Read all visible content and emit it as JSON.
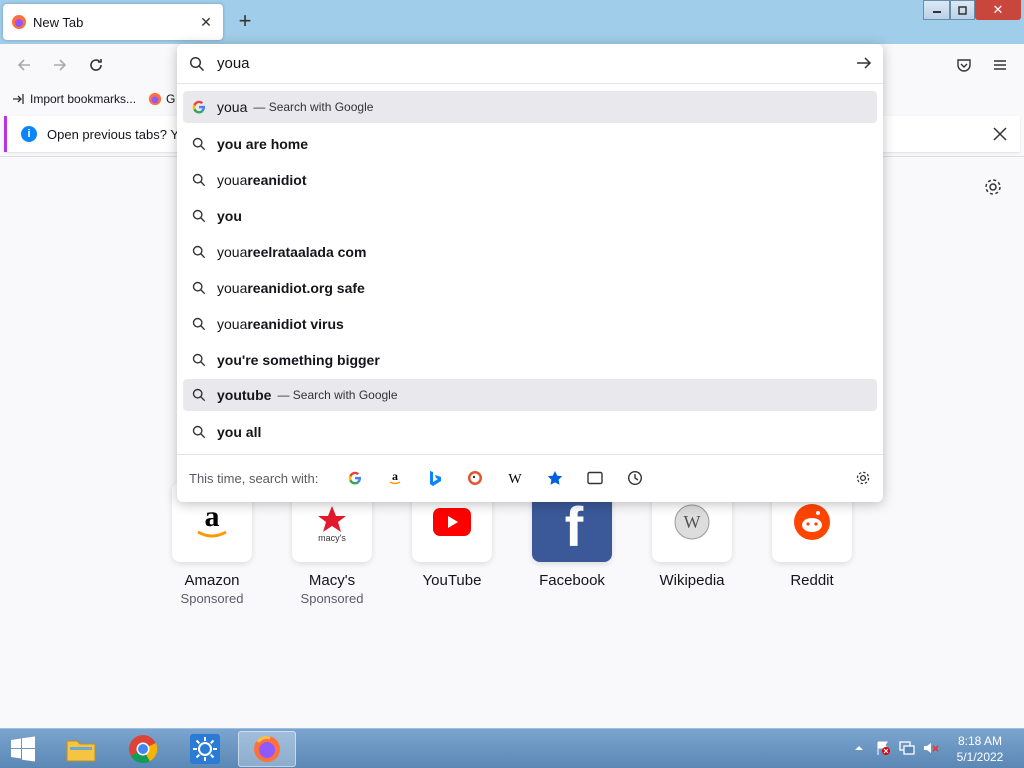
{
  "tab": {
    "title": "New Tab"
  },
  "bookmarks": {
    "items": [
      "Import bookmarks...",
      "G"
    ]
  },
  "notification": {
    "text": "Open previous tabs? You"
  },
  "urlbar": {
    "value": "youa"
  },
  "suggestions": [
    {
      "typed": "youa",
      "bold": "",
      "action": "— Search with Google",
      "icon": "google-icon",
      "highlighted": true
    },
    {
      "typed": "",
      "bold": "you are home",
      "action": "",
      "icon": "search-icon",
      "highlighted": false
    },
    {
      "typed": "youa",
      "bold": "reanidiot",
      "action": "",
      "icon": "search-icon",
      "highlighted": false
    },
    {
      "typed": "",
      "bold": "you",
      "action": "",
      "icon": "search-icon",
      "highlighted": false
    },
    {
      "typed": "youa",
      "bold": "reelrataalada com",
      "action": "",
      "icon": "search-icon",
      "highlighted": false
    },
    {
      "typed": "youa",
      "bold": "reanidiot.org safe",
      "action": "",
      "icon": "search-icon",
      "highlighted": false
    },
    {
      "typed": "youa",
      "bold": "reanidiot virus",
      "action": "",
      "icon": "search-icon",
      "highlighted": false
    },
    {
      "typed": "",
      "bold": "you're something bigger",
      "action": "",
      "icon": "search-icon",
      "highlighted": false
    },
    {
      "typed": "",
      "bold": "youtube",
      "action": "— Search with Google",
      "icon": "search-icon",
      "highlighted": true
    },
    {
      "typed": "",
      "bold": "you all",
      "action": "",
      "icon": "search-icon",
      "highlighted": false
    }
  ],
  "oneoff": {
    "label": "This time, search with:",
    "engines": [
      "google-icon",
      "amazon-icon",
      "bing-icon",
      "duckduckgo-icon",
      "wikipedia-icon",
      "bookmarks-star-icon",
      "tabs-icon",
      "history-icon"
    ]
  },
  "topsites": [
    {
      "name": "Amazon",
      "sponsor": "Sponsored",
      "icon": "amazon-icon"
    },
    {
      "name": "Macy's",
      "sponsor": "Sponsored",
      "icon": "macys-icon"
    },
    {
      "name": "YouTube",
      "sponsor": "",
      "icon": "youtube-icon"
    },
    {
      "name": "Facebook",
      "sponsor": "",
      "icon": "facebook-icon"
    },
    {
      "name": "Wikipedia",
      "sponsor": "",
      "icon": "wikipedia-icon"
    },
    {
      "name": "Reddit",
      "sponsor": "",
      "icon": "reddit-icon"
    }
  ],
  "clock": {
    "time": "8:18 AM",
    "date": "5/1/2022"
  },
  "colors": {
    "titlebar": "#a0cde9",
    "highlight": "#e9e9ed",
    "notif_accent": "#b833e1",
    "info_blue": "#0a84ff"
  }
}
